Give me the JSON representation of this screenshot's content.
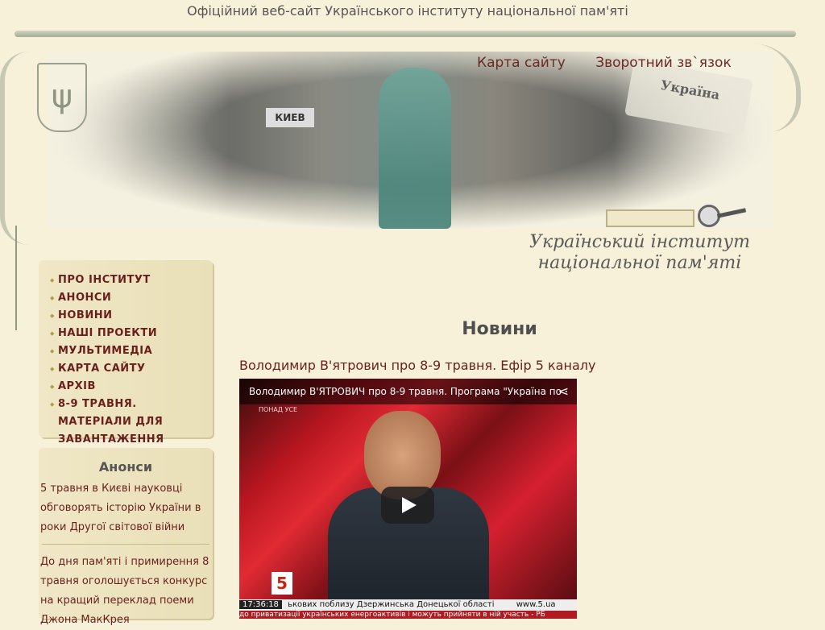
{
  "site": {
    "tagline": "Офіційний веб-сайт Українського інституту національної пам'яті",
    "institute_line1": "Український інститут",
    "institute_line2": "національної пам'яті",
    "banner_text": "Україна",
    "sign_text": "КИЕВ"
  },
  "header": {
    "links": [
      {
        "label": "Карта сайту"
      },
      {
        "label": "Зворотний зв`язок"
      }
    ]
  },
  "nav": {
    "items": [
      {
        "label": "ПРО ІНСТИТУТ"
      },
      {
        "label": "АНОНСИ"
      },
      {
        "label": "НОВИНИ"
      },
      {
        "label": "НАШІ ПРОЕКТИ"
      },
      {
        "label": "МУЛЬТИМЕДІА"
      },
      {
        "label": "КАРТА САЙТУ"
      },
      {
        "label": "АРХІВ"
      },
      {
        "label": "8-9 ТРАВНЯ. МАТЕРІАЛИ ДЛЯ ЗАВАНТАЖЕННЯ"
      }
    ]
  },
  "anons": {
    "title": "Анонси",
    "items": [
      {
        "text": "5 травня в Києві науковці обговорять історію України в роки Другої світової війни"
      },
      {
        "text": "До дня пам'яті і примирення 8 травня оголошується конкурс на кращий переклад поеми Джона МакКрея"
      }
    ]
  },
  "main": {
    "section_title": "Новини",
    "article_title": "Володимир В'ятрович про 8-9 травня. Ефір 5 каналу",
    "video": {
      "title": "Володимир В'ЯТРОВИЧ про 8-9 травня. Програма \"Україна по",
      "brand_text": "ПОНАД УСЕ",
      "channel": "5",
      "time": "17:36:18",
      "ticker_line1": "ькових поблизу Дзержинська Донецької області",
      "ticker_site": "www.5.ua",
      "ticker_line2": "до приватизації українських енергоактивів і можуть прийняти в ній участь - РБ"
    }
  }
}
